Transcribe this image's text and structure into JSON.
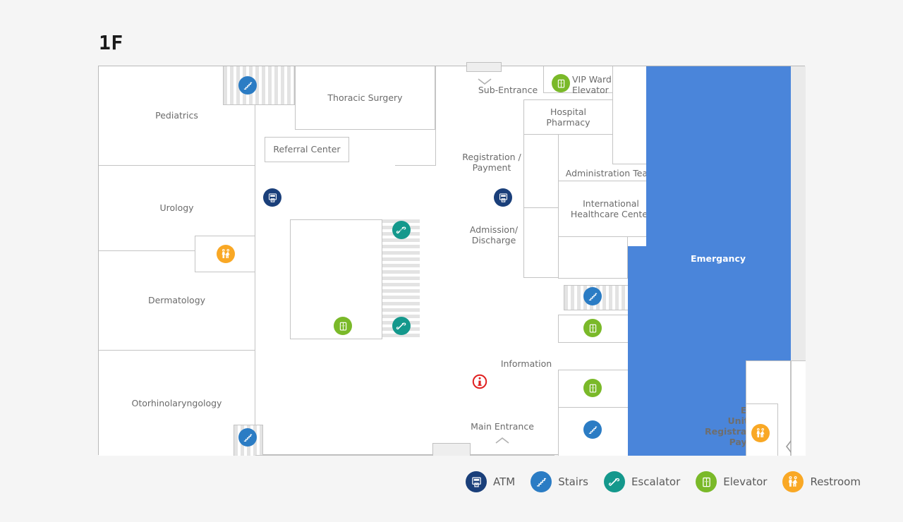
{
  "floor": {
    "title": "1F"
  },
  "colors": {
    "atm": "#1a3f7a",
    "stairs": "#2b7cc4",
    "escalator": "#14988c",
    "elevator": "#7ab929",
    "restroom": "#f9a825",
    "emergency_zone": "#4a85da",
    "information": "#e02020",
    "room_border": "#c4c4c4",
    "room_label": "#6b6b6b"
  },
  "rooms": [
    {
      "id": "pediatrics",
      "label": "Pediatrics"
    },
    {
      "id": "urology",
      "label": "Urology"
    },
    {
      "id": "dermatology",
      "label": "Dermatology"
    },
    {
      "id": "otorhinolaryngology",
      "label": "Otorhinolaryngology"
    },
    {
      "id": "thoracic-surgery",
      "label": "Thoracic Surgery"
    },
    {
      "id": "referral-center",
      "label": "Referral Center"
    },
    {
      "id": "hospital-pharmacy",
      "label": "Hospital\nPharmacy"
    },
    {
      "id": "administration-team",
      "label": "Administration Team"
    },
    {
      "id": "international-healthcare-center",
      "label": "International\nHealthcare Center"
    }
  ],
  "free_labels": {
    "sub_entrance": "Sub-Entrance",
    "main_entrance": "Main Entrance",
    "registration_payment": "Registration /\nPayment",
    "admission_discharge": "Admission/\nDischarge",
    "information": "Information",
    "vip_ward_elevator": "VIP Ward\nElevator",
    "emergency": "Emergancy",
    "emergency_unit_entrance": "Emergency\nUnit Entrance",
    "registration_payment_er": "Registration /\nPayment"
  },
  "legend": [
    {
      "icon": "atm-icon",
      "label": "ATM",
      "color": "#1a3f7a"
    },
    {
      "icon": "stairs-icon",
      "label": "Stairs",
      "color": "#2b7cc4"
    },
    {
      "icon": "escalator-icon",
      "label": "Escalator",
      "color": "#14988c"
    },
    {
      "icon": "elevator-icon",
      "label": "Elevator",
      "color": "#7ab929"
    },
    {
      "icon": "restroom-icon",
      "label": "Restroom",
      "color": "#f9a825"
    }
  ]
}
